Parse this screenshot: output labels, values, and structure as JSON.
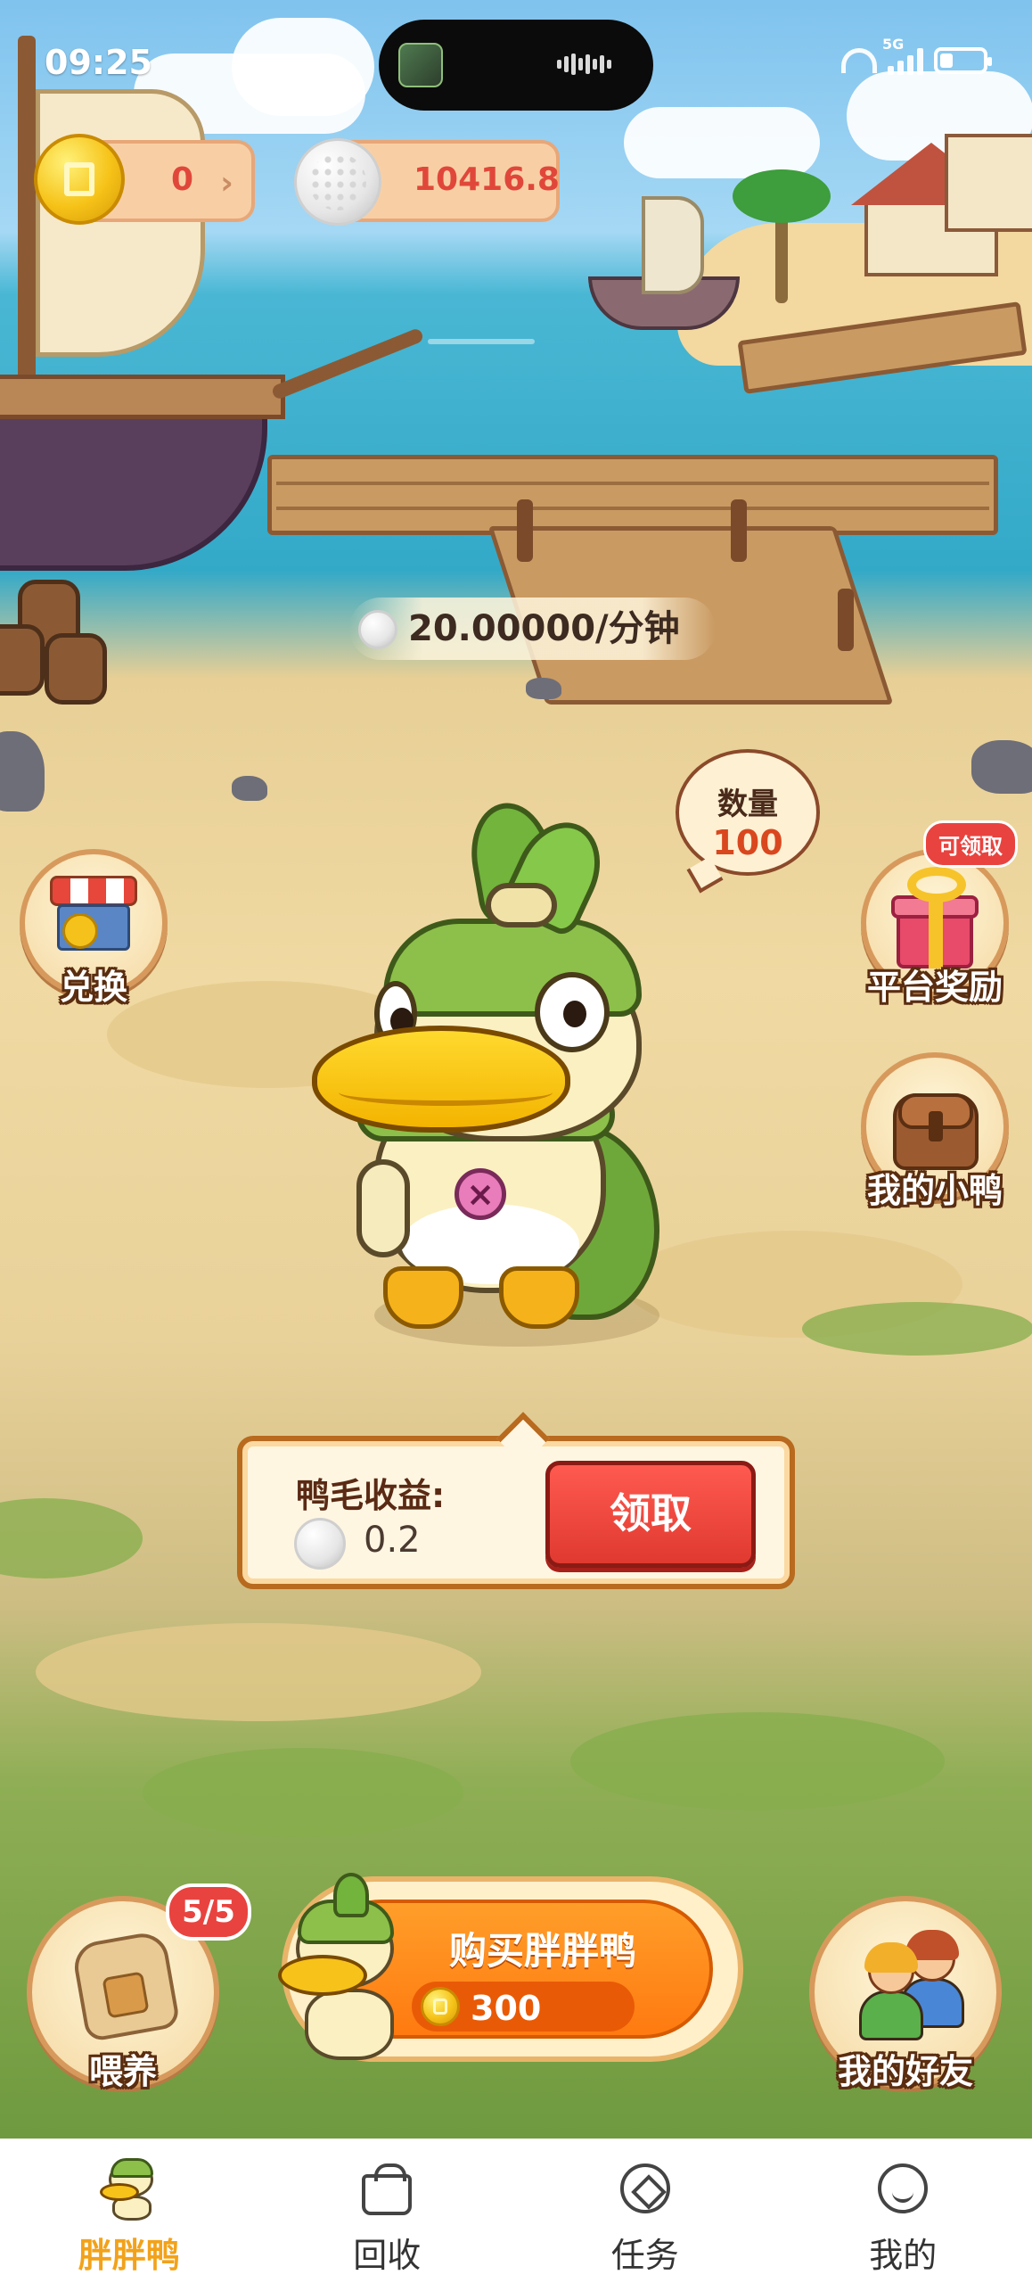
{
  "status_bar": {
    "time": "09:25",
    "network_badge": "5G",
    "battery_level": 0.3
  },
  "currencies": {
    "coin_value": "0",
    "coin_chevron": "›",
    "wool_value": "10416.8"
  },
  "rate": {
    "text": "20.00000/分钟"
  },
  "quantity_bubble": {
    "label": "数量",
    "value": "100"
  },
  "side_buttons": {
    "exchange_label": "兑换",
    "platform_reward_label": "平台奖励",
    "platform_reward_badge": "可领取",
    "my_duck_label": "我的小鸭"
  },
  "earnings": {
    "label": "鸭毛收益:",
    "value": "0.2",
    "claim_label": "领取"
  },
  "bottom_actions": {
    "feed_label": "喂养",
    "feed_badge": "5/5",
    "buy_title": "购买胖胖鸭",
    "buy_price": "300",
    "friends_label": "我的好友"
  },
  "nav": {
    "items": [
      {
        "label": "胖胖鸭",
        "icon": "duck-icon",
        "active": true
      },
      {
        "label": "回收",
        "icon": "shopping-bag-icon",
        "active": false
      },
      {
        "label": "任务",
        "icon": "task-diamond-icon",
        "active": false
      },
      {
        "label": "我的",
        "icon": "smiley-icon",
        "active": false
      }
    ]
  },
  "colors": {
    "accent_red": "#e03a30",
    "accent_orange": "#ff7a10",
    "nav_active": "#f2a21a",
    "coin_gold": "#f6c319"
  }
}
